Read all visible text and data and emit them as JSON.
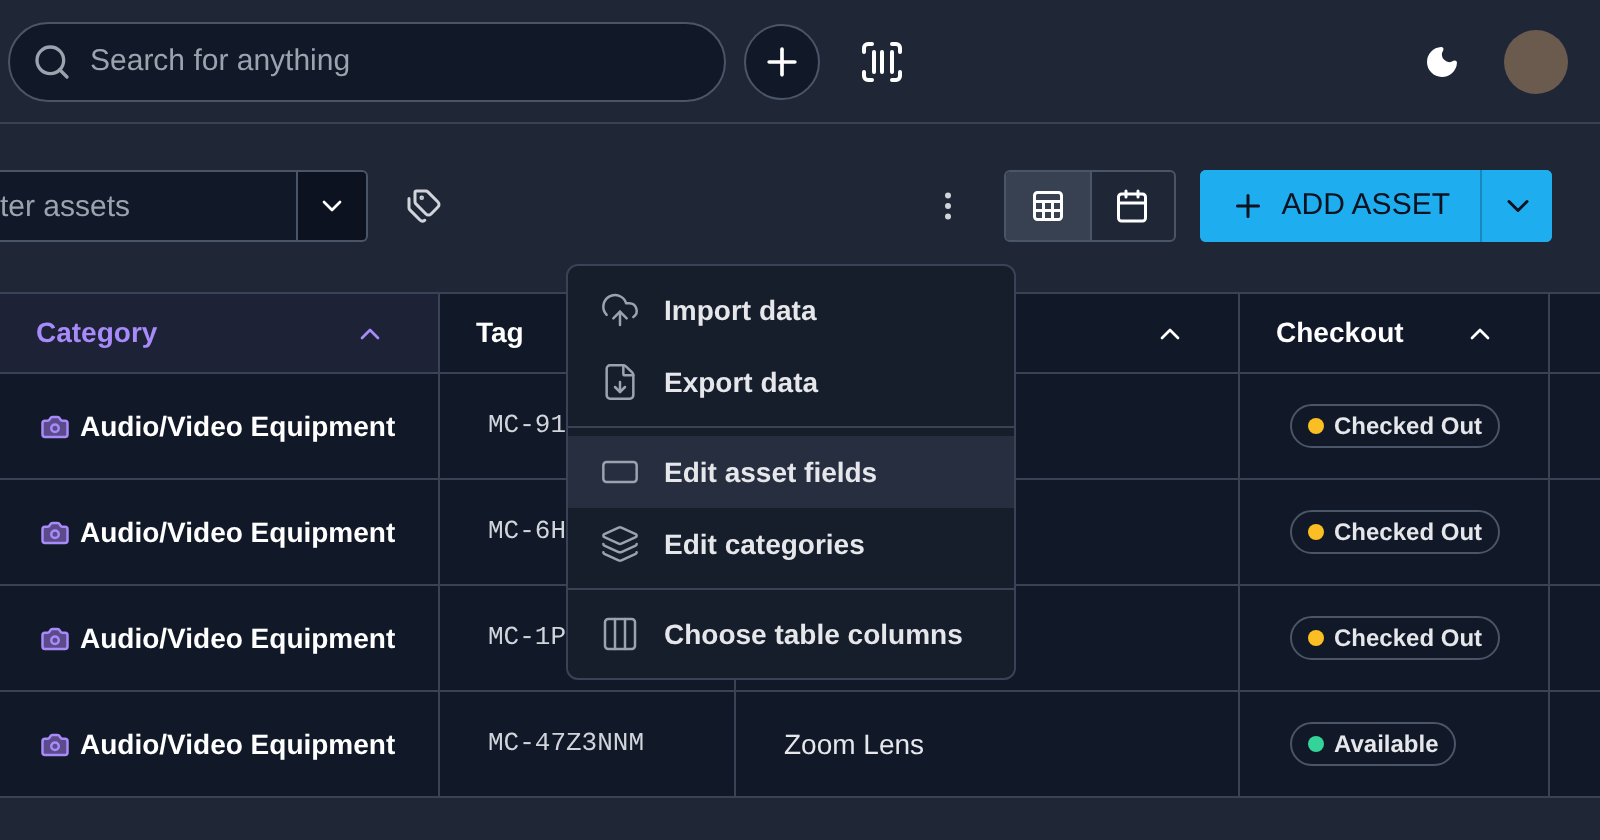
{
  "search": {
    "placeholder": "Search for anything"
  },
  "filter": {
    "placeholder": "ter assets"
  },
  "view_toggle": [
    {
      "kind": "list",
      "selected": true
    },
    {
      "kind": "calendar",
      "selected": false
    }
  ],
  "add_button": {
    "label": "ADD ASSET"
  },
  "table": {
    "columns": [
      {
        "label": "Category",
        "selected": true,
        "sortable": true
      },
      {
        "label": "Tag",
        "selected": false
      },
      {
        "selected": false,
        "sortable": true
      },
      {
        "label": "Checkout",
        "selected": false,
        "sortable": true
      }
    ],
    "rows": [
      {
        "category": "Audio/Video Equipment",
        "tag": "MC-91",
        "checkout": "Checked Out",
        "color": "#fbbf24"
      },
      {
        "category": "Audio/Video Equipment",
        "tag": "MC-6H",
        "checkout": "Checked Out",
        "color": "#fbbf24"
      },
      {
        "category": "Audio/Video Equipment",
        "tag": "MC-1P",
        "checkout": "Checked Out",
        "color": "#fbbf24"
      },
      {
        "category": "Audio/Video Equipment",
        "tag": "MC-47Z3NNM",
        "description": "Zoom Lens",
        "checkout": "Available",
        "color": "#34d399"
      }
    ]
  },
  "menu": {
    "groups": [
      [
        {
          "label": "Import data",
          "kind": "import",
          "highlighted": false
        },
        {
          "label": "Export data",
          "kind": "export",
          "highlighted": false
        }
      ],
      [
        {
          "label": "Edit asset fields",
          "kind": "fields",
          "highlighted": true
        },
        {
          "label": "Edit categories",
          "kind": "categories",
          "highlighted": false
        }
      ],
      [
        {
          "label": "Choose table columns",
          "kind": "columns",
          "highlighted": false
        }
      ]
    ]
  }
}
